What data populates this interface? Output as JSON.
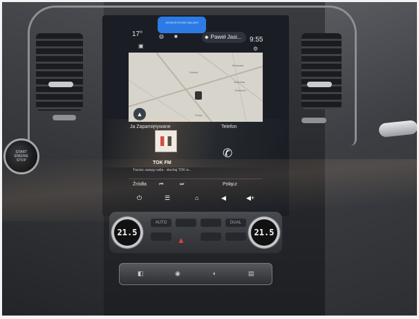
{
  "status_bar": {
    "temperature": "17°",
    "user_name": "Paweł Jasi...",
    "time": "9:55",
    "notification_text": "JEDNOSTKOWE BALANS"
  },
  "map": {
    "labels": [
      "Dolinki",
      "Mostowa",
      "Złotnicka",
      "Rolnicza",
      "Polna"
    ]
  },
  "widgets": {
    "radio_title": "Ja Zapamiętywane",
    "phone_title": "Telefon",
    "station_name": "TOK FM",
    "station_subtitle": "Tracisz zasięg radia - słuchaj TOK w..."
  },
  "sources_row": {
    "sources": "Źródła",
    "prev": "⏮",
    "next": "⏭",
    "connect": "Połącz"
  },
  "dock": {
    "power": "⏻",
    "menu": "☰",
    "home": "⌂",
    "vol_down": "◀",
    "vol_up": "◀+"
  },
  "climate": {
    "left_temp": "21.5",
    "right_temp": "21.5",
    "left_unit": "AUTO",
    "right_unit": "DUAL"
  },
  "start_button": {
    "line1": "START",
    "line2": "ENGINE",
    "line3": "STOP"
  },
  "colors": {
    "screen_bg": "#1a1e24",
    "map_bg": "#d7d4cc",
    "accent_blue": "#2c7be5",
    "hazard_red": "#e04040"
  }
}
